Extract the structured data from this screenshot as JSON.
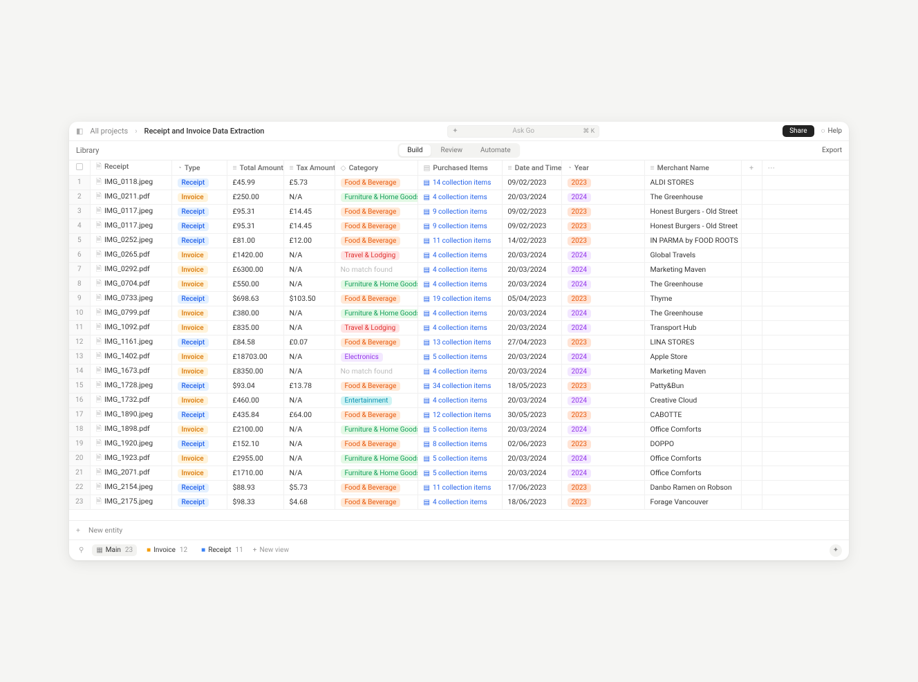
{
  "breadcrumb": {
    "all": "All projects",
    "current": "Receipt and Invoice Data Extraction"
  },
  "askgo_placeholder": "Ask Go",
  "askgo_kbd": "⌘ K",
  "share": "Share",
  "help": "Help",
  "library": "Library",
  "tabs": {
    "build": "Build",
    "review": "Review",
    "automate": "Automate"
  },
  "export": "Export",
  "headers": {
    "receipt": "Receipt",
    "type": "Type",
    "total": "Total Amount",
    "tax": "Tax Amount",
    "category": "Category",
    "items": "Purchased Items",
    "date": "Date and Time",
    "year": "Year",
    "merchant": "Merchant Name"
  },
  "new_entity": "New entity",
  "views": {
    "main": {
      "label": "Main",
      "count": "23"
    },
    "invoice": {
      "label": "Invoice",
      "count": "12"
    },
    "receipt": {
      "label": "Receipt",
      "count": "11"
    },
    "new": "New view"
  },
  "rows": [
    {
      "n": "1",
      "file": "IMG_0118.jpeg",
      "type": "Receipt",
      "total": "£45.99",
      "tax": "£5.73",
      "category": "Food & Beverage",
      "cat": "food",
      "items": "14 collection items",
      "date": "09/02/2023",
      "year": "2023",
      "merchant": "ALDI STORES"
    },
    {
      "n": "2",
      "file": "IMG_0211.pdf",
      "type": "Invoice",
      "total": "£250.00",
      "tax": "N/A",
      "category": "Furniture & Home Goods",
      "cat": "furniture",
      "items": "4 collection items",
      "date": "20/03/2024",
      "year": "2024",
      "merchant": "The Greenhouse"
    },
    {
      "n": "3",
      "file": "IMG_0117.jpeg",
      "type": "Receipt",
      "total": "£95.31",
      "tax": "£14.45",
      "category": "Food & Beverage",
      "cat": "food",
      "items": "9 collection items",
      "date": "09/02/2023",
      "year": "2023",
      "merchant": "Honest Burgers - Old Street"
    },
    {
      "n": "4",
      "file": "IMG_0117.jpeg",
      "type": "Receipt",
      "total": "£95.31",
      "tax": "£14.45",
      "category": "Food & Beverage",
      "cat": "food",
      "items": "9 collection items",
      "date": "09/02/2023",
      "year": "2023",
      "merchant": "Honest Burgers - Old Street"
    },
    {
      "n": "5",
      "file": "IMG_0252.jpeg",
      "type": "Receipt",
      "total": "£81.00",
      "tax": "£12.00",
      "category": "Food & Beverage",
      "cat": "food",
      "items": "11 collection items",
      "date": "14/02/2023",
      "year": "2023",
      "merchant": "IN PARMA by FOOD ROOTS"
    },
    {
      "n": "6",
      "file": "IMG_0265.pdf",
      "type": "Invoice",
      "total": "£1420.00",
      "tax": "N/A",
      "category": "Travel & Lodging",
      "cat": "travel",
      "items": "4 collection items",
      "date": "20/03/2024",
      "year": "2024",
      "merchant": "Global Travels"
    },
    {
      "n": "7",
      "file": "IMG_0292.pdf",
      "type": "Invoice",
      "total": "£6300.00",
      "tax": "N/A",
      "category": "No match found",
      "cat": "nomatch",
      "items": "4 collection items",
      "date": "20/03/2024",
      "year": "2024",
      "merchant": "Marketing Maven"
    },
    {
      "n": "8",
      "file": "IMG_0704.pdf",
      "type": "Invoice",
      "total": "£550.00",
      "tax": "N/A",
      "category": "Furniture & Home Goods",
      "cat": "furniture",
      "items": "4 collection items",
      "date": "20/03/2024",
      "year": "2024",
      "merchant": "The Greenhouse"
    },
    {
      "n": "9",
      "file": "IMG_0733.jpeg",
      "type": "Receipt",
      "total": "$698.63",
      "tax": "$103.50",
      "category": "Food & Beverage",
      "cat": "food",
      "items": "19 collection items",
      "date": "05/04/2023",
      "year": "2023",
      "merchant": "Thyme"
    },
    {
      "n": "10",
      "file": "IMG_0799.pdf",
      "type": "Invoice",
      "total": "£380.00",
      "tax": "N/A",
      "category": "Furniture & Home Goods",
      "cat": "furniture",
      "items": "4 collection items",
      "date": "20/03/2024",
      "year": "2024",
      "merchant": "The Greenhouse"
    },
    {
      "n": "11",
      "file": "IMG_1092.pdf",
      "type": "Invoice",
      "total": "£835.00",
      "tax": "N/A",
      "category": "Travel & Lodging",
      "cat": "travel",
      "items": "4 collection items",
      "date": "20/03/2024",
      "year": "2024",
      "merchant": "Transport Hub"
    },
    {
      "n": "12",
      "file": "IMG_1161.jpeg",
      "type": "Receipt",
      "total": "£84.58",
      "tax": "£0.07",
      "category": "Food & Beverage",
      "cat": "food",
      "items": "13 collection items",
      "date": "27/04/2023",
      "year": "2023",
      "merchant": "LINA STORES"
    },
    {
      "n": "13",
      "file": "IMG_1402.pdf",
      "type": "Invoice",
      "total": "£18703.00",
      "tax": "N/A",
      "category": "Electronics",
      "cat": "electronics",
      "items": "5 collection items",
      "date": "20/03/2024",
      "year": "2024",
      "merchant": "Apple Store"
    },
    {
      "n": "14",
      "file": "IMG_1673.pdf",
      "type": "Invoice",
      "total": "£8350.00",
      "tax": "N/A",
      "category": "No match found",
      "cat": "nomatch",
      "items": "4 collection items",
      "date": "20/03/2024",
      "year": "2024",
      "merchant": "Marketing Maven"
    },
    {
      "n": "15",
      "file": "IMG_1728.jpeg",
      "type": "Receipt",
      "total": "$93.04",
      "tax": "£13.78",
      "category": "Food & Beverage",
      "cat": "food",
      "items": "34 collection items",
      "date": "18/05/2023",
      "year": "2023",
      "merchant": "Patty&Bun"
    },
    {
      "n": "16",
      "file": "IMG_1732.pdf",
      "type": "Invoice",
      "total": "£460.00",
      "tax": "N/A",
      "category": "Entertainment",
      "cat": "entertainment",
      "items": "4 collection items",
      "date": "20/03/2024",
      "year": "2024",
      "merchant": "Creative Cloud"
    },
    {
      "n": "17",
      "file": "IMG_1890.jpeg",
      "type": "Receipt",
      "total": "£435.84",
      "tax": "£64.00",
      "category": "Food & Beverage",
      "cat": "food",
      "items": "12 collection items",
      "date": "30/05/2023",
      "year": "2023",
      "merchant": "CABOTTE"
    },
    {
      "n": "18",
      "file": "IMG_1898.pdf",
      "type": "Invoice",
      "total": "£2100.00",
      "tax": "N/A",
      "category": "Furniture & Home Goods",
      "cat": "furniture",
      "items": "5 collection items",
      "date": "20/03/2024",
      "year": "2024",
      "merchant": "Office Comforts"
    },
    {
      "n": "19",
      "file": "IMG_1920.jpeg",
      "type": "Receipt",
      "total": "£152.10",
      "tax": "N/A",
      "category": "Food & Beverage",
      "cat": "food",
      "items": "8 collection items",
      "date": "02/06/2023",
      "year": "2023",
      "merchant": "DOPPO"
    },
    {
      "n": "20",
      "file": "IMG_1923.pdf",
      "type": "Invoice",
      "total": "£2955.00",
      "tax": "N/A",
      "category": "Furniture & Home Goods",
      "cat": "furniture",
      "items": "5 collection items",
      "date": "20/03/2024",
      "year": "2024",
      "merchant": "Office Comforts"
    },
    {
      "n": "21",
      "file": "IMG_2071.pdf",
      "type": "Invoice",
      "total": "£1710.00",
      "tax": "N/A",
      "category": "Furniture & Home Goods",
      "cat": "furniture",
      "items": "5 collection items",
      "date": "20/03/2024",
      "year": "2024",
      "merchant": "Office Comforts"
    },
    {
      "n": "22",
      "file": "IMG_2154.jpeg",
      "type": "Receipt",
      "total": "$88.93",
      "tax": "$5.73",
      "category": "Food & Beverage",
      "cat": "food",
      "items": "11 collection items",
      "date": "17/06/2023",
      "year": "2023",
      "merchant": "Danbo Ramen on Robson"
    },
    {
      "n": "23",
      "file": "IMG_2175.jpeg",
      "type": "Receipt",
      "total": "$98.33",
      "tax": "$4.68",
      "category": "Food & Beverage",
      "cat": "food",
      "items": "4 collection items",
      "date": "18/06/2023",
      "year": "2023",
      "merchant": "Forage Vancouver"
    }
  ]
}
